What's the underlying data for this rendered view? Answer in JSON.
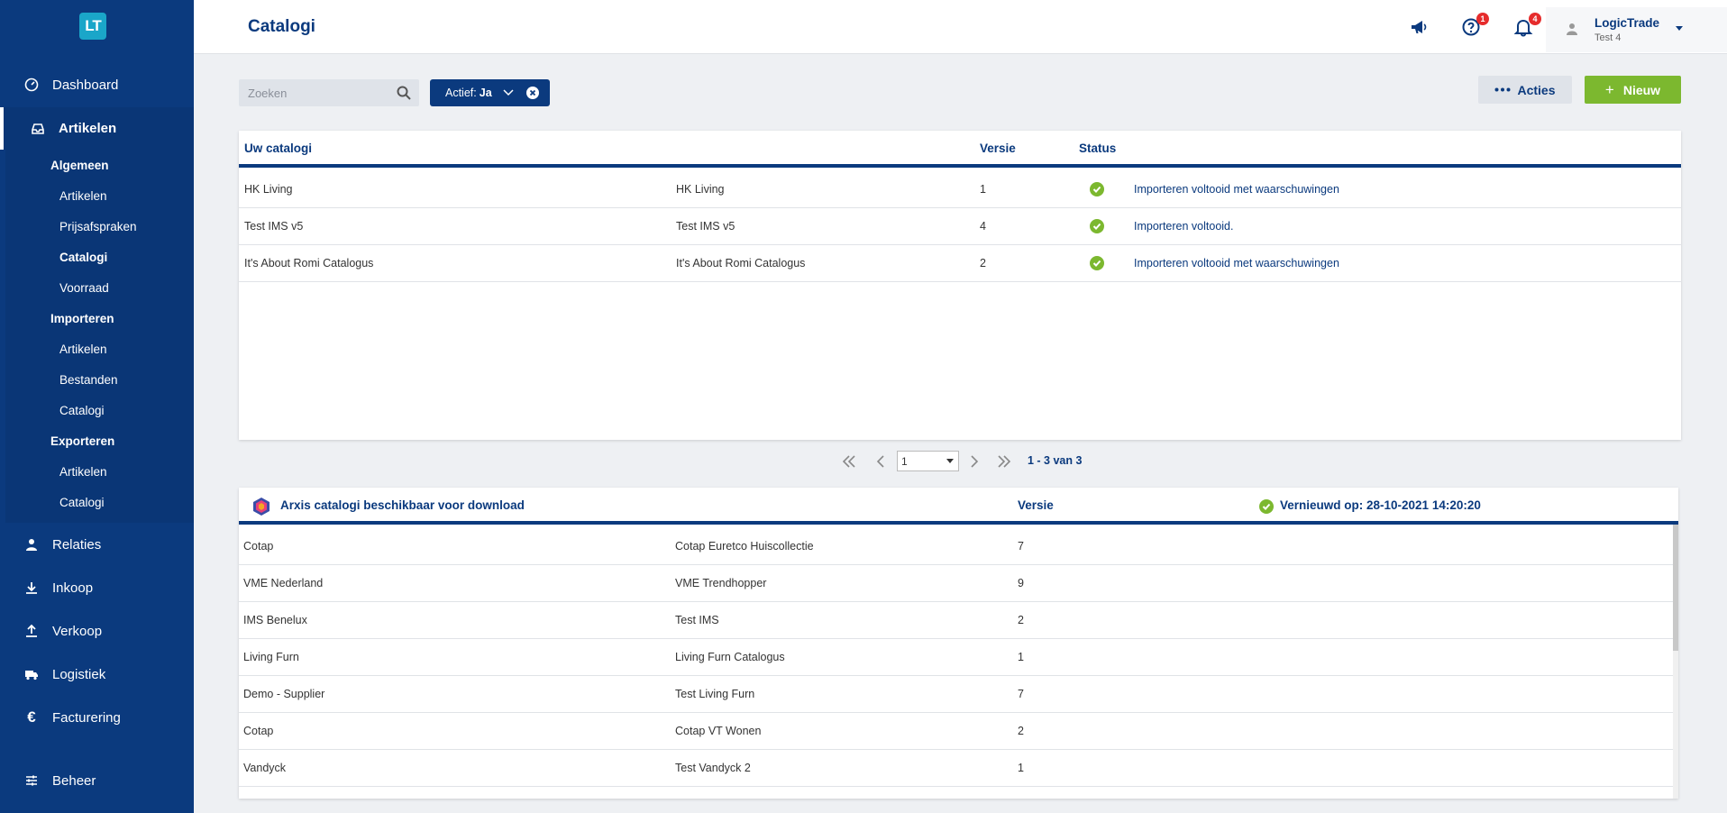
{
  "logo": "LT",
  "header": {
    "title": "Catalogi",
    "help_badge": "1",
    "notifications_badge": "4",
    "user_name": "LogicTrade",
    "user_sub": "Test 4"
  },
  "nav": {
    "dashboard": "Dashboard",
    "artikelen": "Artikelen",
    "relaties": "Relaties",
    "inkoop": "Inkoop",
    "verkoop": "Verkoop",
    "logistiek": "Logistiek",
    "facturering": "Facturering",
    "beheer": "Beheer"
  },
  "submenu": {
    "algemeen": "Algemeen",
    "algemeen_artikelen": "Artikelen",
    "prijsafspraken": "Prijsafspraken",
    "catalogi": "Catalogi",
    "voorraad": "Voorraad",
    "importeren": "Importeren",
    "imp_artikelen": "Artikelen",
    "imp_bestanden": "Bestanden",
    "imp_catalogi": "Catalogi",
    "exporteren": "Exporteren",
    "exp_artikelen": "Artikelen",
    "exp_catalogi": "Catalogi"
  },
  "toolbar": {
    "search_placeholder": "Zoeken",
    "filter_label": "Actief:",
    "filter_value": "Ja",
    "acties_label": "Acties",
    "nieuw_label": "Nieuw"
  },
  "catalogs": {
    "col_name": "Uw catalogi",
    "col_version": "Versie",
    "col_status": "Status",
    "rows": [
      {
        "name": "HK Living",
        "name2": "HK Living",
        "version": "1",
        "status": "Importeren voltooid met waarschuwingen"
      },
      {
        "name": "Test IMS v5",
        "name2": "Test IMS v5",
        "version": "4",
        "status": "Importeren voltooid."
      },
      {
        "name": "It's About Romi Catalogus",
        "name2": "It's About Romi Catalogus",
        "version": "2",
        "status": "Importeren voltooid met waarschuwingen"
      }
    ]
  },
  "pagination": {
    "page": "1",
    "info": "1 - 3 van 3"
  },
  "arxis": {
    "title": "Arxis catalogi beschikbaar voor download",
    "col_version": "Versie",
    "renewed": "Vernieuwd op: 28-10-2021 14:20:20",
    "rows": [
      {
        "supplier": "Cotap",
        "catalog": "Cotap Euretco Huiscollectie",
        "version": "7"
      },
      {
        "supplier": "VME Nederland",
        "catalog": "VME Trendhopper",
        "version": "9"
      },
      {
        "supplier": "IMS Benelux",
        "catalog": "Test IMS",
        "version": "2"
      },
      {
        "supplier": "Living Furn",
        "catalog": "Living Furn Catalogus",
        "version": "1"
      },
      {
        "supplier": "Demo - Supplier",
        "catalog": "Test Living Furn",
        "version": "7"
      },
      {
        "supplier": "Cotap",
        "catalog": "Cotap VT Wonen",
        "version": "2"
      },
      {
        "supplier": "Vandyck",
        "catalog": "Test Vandyck 2",
        "version": "1"
      }
    ]
  },
  "colors": {
    "primary": "#0b3a7e",
    "success": "#7cb82f",
    "badge": "#e62c2c"
  }
}
